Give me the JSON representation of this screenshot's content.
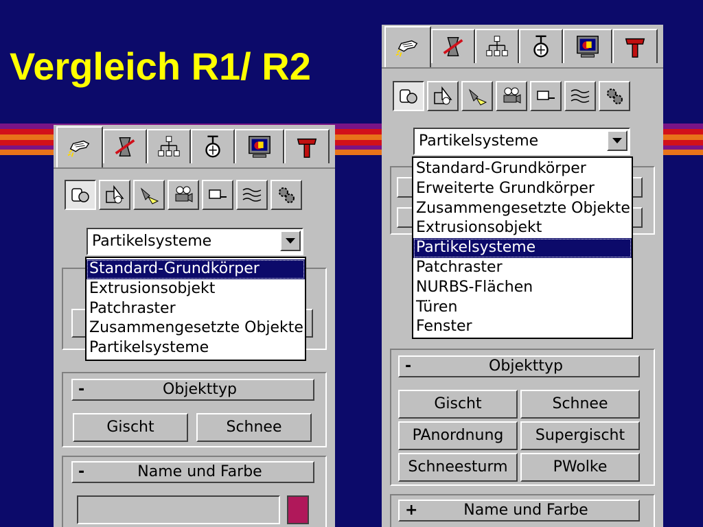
{
  "slide": {
    "title": "Vergleich R1/ R2",
    "colors": {
      "background": "#0c0a6a",
      "title": "#ffff00",
      "selection": "#0c0a6a"
    }
  },
  "tab_icons": [
    "create-hand-icon",
    "modify-icon",
    "hierarchy-icon",
    "motion-icon",
    "display-icon",
    "utilities-hammer-icon"
  ],
  "category_icons": [
    "geometry-icon",
    "shapes-icon",
    "lights-icon",
    "cameras-icon",
    "helpers-icon",
    "space-warps-icon",
    "systems-icon"
  ],
  "left_panel": {
    "combo_value": "Partikelsysteme",
    "dropdown_options": [
      "Standard-Grundkörper",
      "Extrusionsobjekt",
      "Patchraster",
      "Zusammengesetzte Objekte",
      "Partikelsysteme"
    ],
    "selected_option": "Standard-Grundkörper",
    "objekttyp": {
      "sign": "-",
      "title": "Objekttyp",
      "buttons": [
        "Gischt",
        "Schnee"
      ]
    },
    "name_und_farbe": {
      "sign": "-",
      "title": "Name und Farbe",
      "name_value": "",
      "color": "#b0185a"
    }
  },
  "right_panel": {
    "combo_value": "Partikelsysteme",
    "dropdown_options": [
      "Standard-Grundkörper",
      "Erweiterte Grundkörper",
      "Zusammengesetzte Objekte",
      "Extrusionsobjekt",
      "Partikelsysteme",
      "Patchraster",
      "NURBS-Flächen",
      "Türen",
      "Fenster"
    ],
    "selected_option": "Partikelsysteme",
    "objekttyp": {
      "sign": "-",
      "title": "Objekttyp",
      "buttons": [
        "Gischt",
        "Schnee",
        "PAnordnung",
        "Supergischt",
        "Schneesturm",
        "PWolke"
      ]
    },
    "name_und_farbe": {
      "sign": "+",
      "title": "Name und Farbe"
    }
  }
}
